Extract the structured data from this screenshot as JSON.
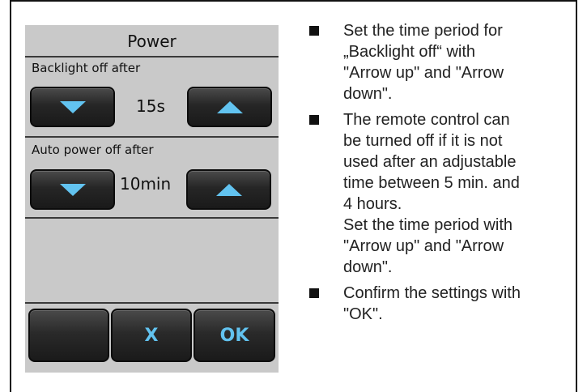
{
  "screen": {
    "title": "Power",
    "backlight": {
      "label": "Backlight off after",
      "value": "15s"
    },
    "auto_power": {
      "label": "Auto power off after",
      "value": "10min"
    },
    "buttons": {
      "blank": "",
      "cancel": "X",
      "ok": "OK"
    },
    "colors": {
      "screen_bg": "#c9c9c9",
      "button_bg": "#2a2a2a",
      "accent": "#62c3f0"
    },
    "icons": {
      "down": "arrow-down-icon",
      "up": "arrow-up-icon"
    }
  },
  "instructions": [
    {
      "text": "Set the time period for\n„Backlight off“ with\n\"Arrow up\" and \"Arrow\ndown\"."
    },
    {
      "text": "The remote control can\nbe turned off if it is not\nused after an adjustable\ntime between 5 min. and\n4 hours.\nSet the time period with\n\"Arrow up\" and \"Arrow\ndown\"."
    },
    {
      "text": "Confirm the settings with\n\"OK\"."
    }
  ]
}
